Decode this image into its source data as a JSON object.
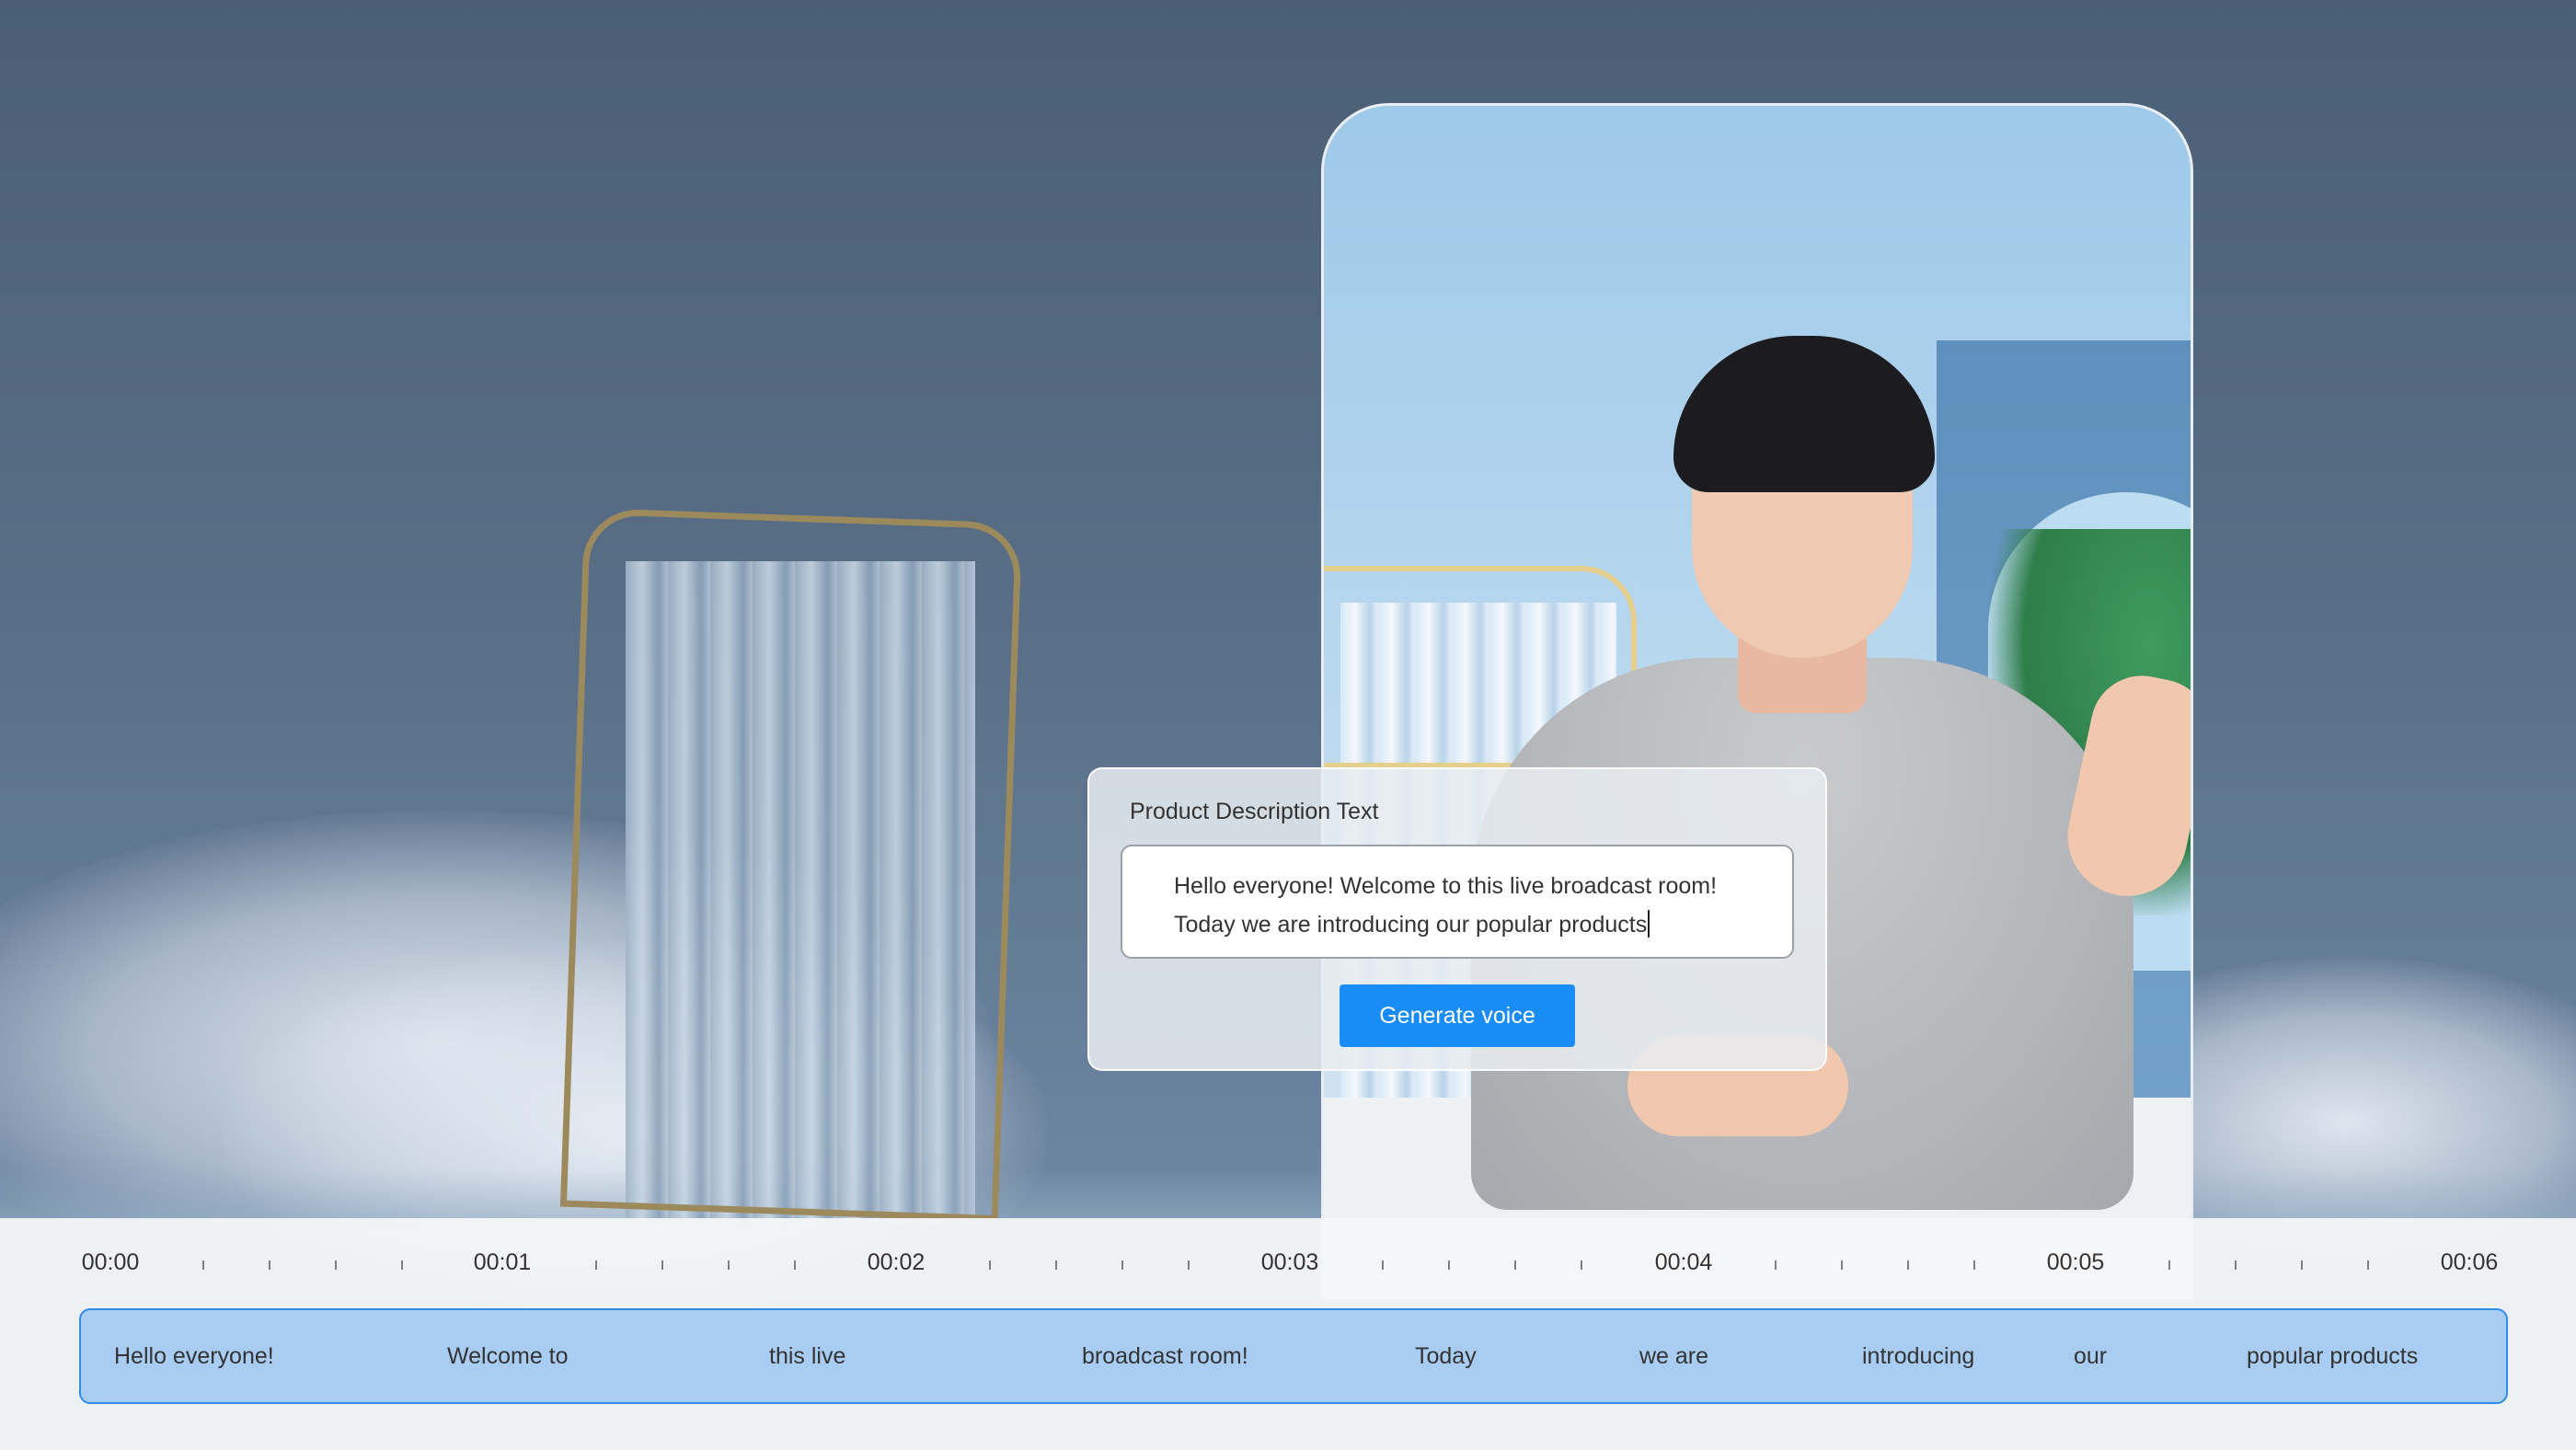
{
  "card": {
    "title": "Product Description Text",
    "line1": "Hello everyone! Welcome to this live broadcast room!",
    "line2": "Today we are introducing our popular products",
    "generate_label": "Generate voice"
  },
  "timeline": {
    "time_labels": [
      "00:00",
      "00:01",
      "00:02",
      "00:03",
      "00:04",
      "00:05",
      "00:06"
    ],
    "words": [
      "Hello everyone!",
      "Welcome to",
      "this live",
      "broadcast room!",
      "Today",
      "we are",
      "introducing",
      "our",
      "popular products"
    ]
  },
  "colors": {
    "accent": "#1a8cf5",
    "track_fill": "#a9cdf2",
    "track_border": "#2f8ce8"
  }
}
